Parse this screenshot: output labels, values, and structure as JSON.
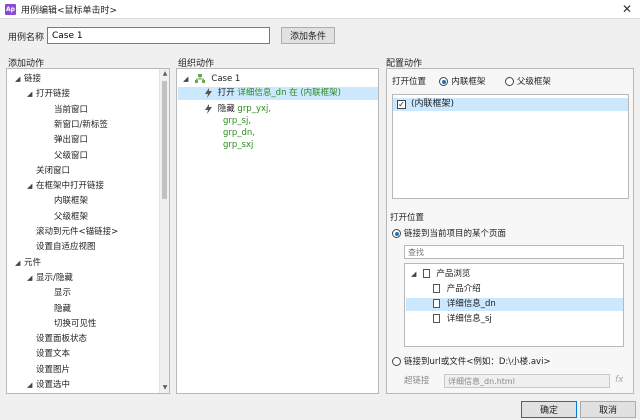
{
  "window": {
    "title": "用例编辑<鼠标单击时>",
    "app_icon": "Ap",
    "close_icon": "✕"
  },
  "case_name": {
    "label": "用例名称",
    "value": "Case 1",
    "add_condition": "添加条件"
  },
  "sections": {
    "add_action": "添加动作",
    "organize_action": "组织动作",
    "config_action": "配置动作"
  },
  "action_tree": [
    {
      "label": "链接",
      "level": 0,
      "expanded": true
    },
    {
      "label": "打开链接",
      "level": 1,
      "expanded": true
    },
    {
      "label": "当前窗口",
      "level": 2
    },
    {
      "label": "新窗口/新标签",
      "level": 2
    },
    {
      "label": "弹出窗口",
      "level": 2
    },
    {
      "label": "父级窗口",
      "level": 2
    },
    {
      "label": "关闭窗口",
      "level": 1
    },
    {
      "label": "在框架中打开链接",
      "level": 1,
      "expanded": true
    },
    {
      "label": "内联框架",
      "level": 2
    },
    {
      "label": "父级框架",
      "level": 2
    },
    {
      "label": "滚动到元件<锚链接>",
      "level": 1
    },
    {
      "label": "设置自适应视图",
      "level": 1
    },
    {
      "label": "元件",
      "level": 0,
      "expanded": true
    },
    {
      "label": "显示/隐藏",
      "level": 1,
      "expanded": true
    },
    {
      "label": "显示",
      "level": 2
    },
    {
      "label": "隐藏",
      "level": 2
    },
    {
      "label": "切换可见性",
      "level": 2
    },
    {
      "label": "设置面板状态",
      "level": 1
    },
    {
      "label": "设置文本",
      "level": 1
    },
    {
      "label": "设置图片",
      "level": 1
    },
    {
      "label": "设置选中",
      "level": 1,
      "expanded": true
    }
  ],
  "organize": {
    "case_label": "Case 1",
    "action1_verb": "打开",
    "action1_target": "详细信息_dn 在 (内联框架)",
    "action2_verb": "隐藏",
    "action2_targets": [
      "grp_yxj,",
      "grp_sj,",
      "grp_dn,",
      "grp_sxj"
    ]
  },
  "config": {
    "open_location_label": "打开位置",
    "inline_frame": "内联框架",
    "parent_frame": "父级框架",
    "frame_item": "(内联框架)",
    "open_location_label2": "打开位置",
    "link_current_project": "链接到当前项目的某个页面",
    "search_placeholder": "查找",
    "pages": [
      {
        "label": "产品浏览",
        "level": 0,
        "expanded": true
      },
      {
        "label": "产品介绍",
        "level": 1
      },
      {
        "label": "详细信息_dn",
        "level": 1,
        "selected": true
      },
      {
        "label": "详细信息_sj",
        "level": 1
      }
    ],
    "link_url_label": "链接到url或文件<例如：D:\\小楼.avi>",
    "hyperlink_label": "超链接",
    "hyperlink_value": "详细信息_dn.html",
    "fx": "fx"
  },
  "buttons": {
    "ok": "确定",
    "cancel": "取消"
  }
}
